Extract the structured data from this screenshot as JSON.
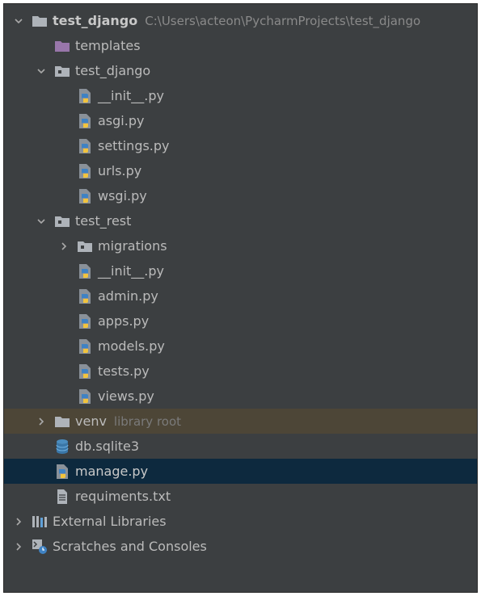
{
  "project": {
    "name": "test_django",
    "path": "C:\\Users\\acteon\\PycharmProjects\\test_django"
  },
  "tree": {
    "templates": "templates",
    "test_django_pkg": "test_django",
    "test_django_files": [
      "__init__.py",
      "asgi.py",
      "settings.py",
      "urls.py",
      "wsgi.py"
    ],
    "test_rest": "test_rest",
    "migrations": "migrations",
    "test_rest_files": [
      "__init__.py",
      "admin.py",
      "apps.py",
      "models.py",
      "tests.py",
      "views.py"
    ],
    "venv": "venv",
    "venv_hint": "library root",
    "db": "db.sqlite3",
    "manage": "manage.py",
    "requirements": "requiments.txt",
    "external_libraries": "External Libraries",
    "scratches": "Scratches and Consoles"
  },
  "colors": {
    "panel_bg": "#3c3f41",
    "selection_bg": "#0d293e",
    "venv_bg": "#4d4637",
    "text": "#bbbbbb",
    "hint_text": "#7a7a7a",
    "folder_icon": "#aeb3b9",
    "templates_folder_icon": "#9876aa",
    "python_blue": "#3f82c3",
    "python_yellow": "#f2c43d",
    "db_icon": "#4b8dbf"
  }
}
